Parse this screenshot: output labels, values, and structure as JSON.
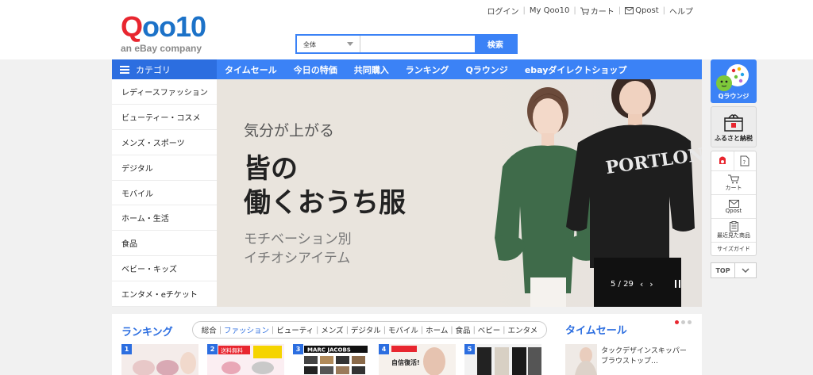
{
  "header": {
    "logo_text_q": "Q",
    "logo_text_rest": "oo10",
    "logo_subtitle": "an eBay company",
    "top_links": [
      "ログイン",
      "My Qoo10",
      "カート",
      "Qpost",
      "ヘルプ"
    ]
  },
  "search": {
    "category_value": "全体",
    "input_value": "",
    "placeholder": "",
    "button_label": "検索"
  },
  "nav": {
    "category_label": "カテゴリ",
    "items": [
      "タイムセール",
      "今日の特価",
      "共同購入",
      "ランキング",
      "Qラウンジ",
      "ebayダイレクトショップ"
    ]
  },
  "sidebar": {
    "items": [
      "レディースファッション",
      "ビューティー・コスメ",
      "メンズ・スポーツ",
      "デジタル",
      "モバイル",
      "ホーム・生活",
      "食品",
      "ベビー・キッズ",
      "エンタメ・eチケット"
    ]
  },
  "banner": {
    "line1": "気分が上がる",
    "line2a": "皆の",
    "line2b": "働くおうち服",
    "line3a": "モチベーション別",
    "line3b": "イチオシアイテム",
    "counter": "5 / 29",
    "shirt_text": "PORTLON"
  },
  "rightbar": {
    "qlounge": "Qラウンジ",
    "furusato": "ふるさと納税",
    "cart": "カート",
    "qpost": "Qpost",
    "recent": "最近見た商品",
    "size_guide": "サイズガイド",
    "top": "TOP"
  },
  "ranking": {
    "title": "ランキング",
    "tabs": [
      "総合",
      "ファッション",
      "ビューティ",
      "メンズ",
      "デジタル",
      "モバイル",
      "ホーム",
      "食品",
      "ベビー",
      "エンタメ"
    ],
    "active_tab": 1,
    "numbers": [
      "1",
      "2",
      "3",
      "4",
      "5"
    ],
    "thumb_texts": [
      "",
      "送料無料",
      "MARC JACOBS",
      "自信復活!",
      ""
    ]
  },
  "timesale": {
    "title": "タイムセール",
    "item_text": "タックデザインスキッパーブラウストップ…"
  },
  "colors": {
    "primary": "#3b82f6",
    "primary_dark": "#2c6ee0",
    "accent_red": "#e8262f",
    "banner_bg": "#e9e4dd",
    "green_blouse": "#3f6b4a"
  }
}
